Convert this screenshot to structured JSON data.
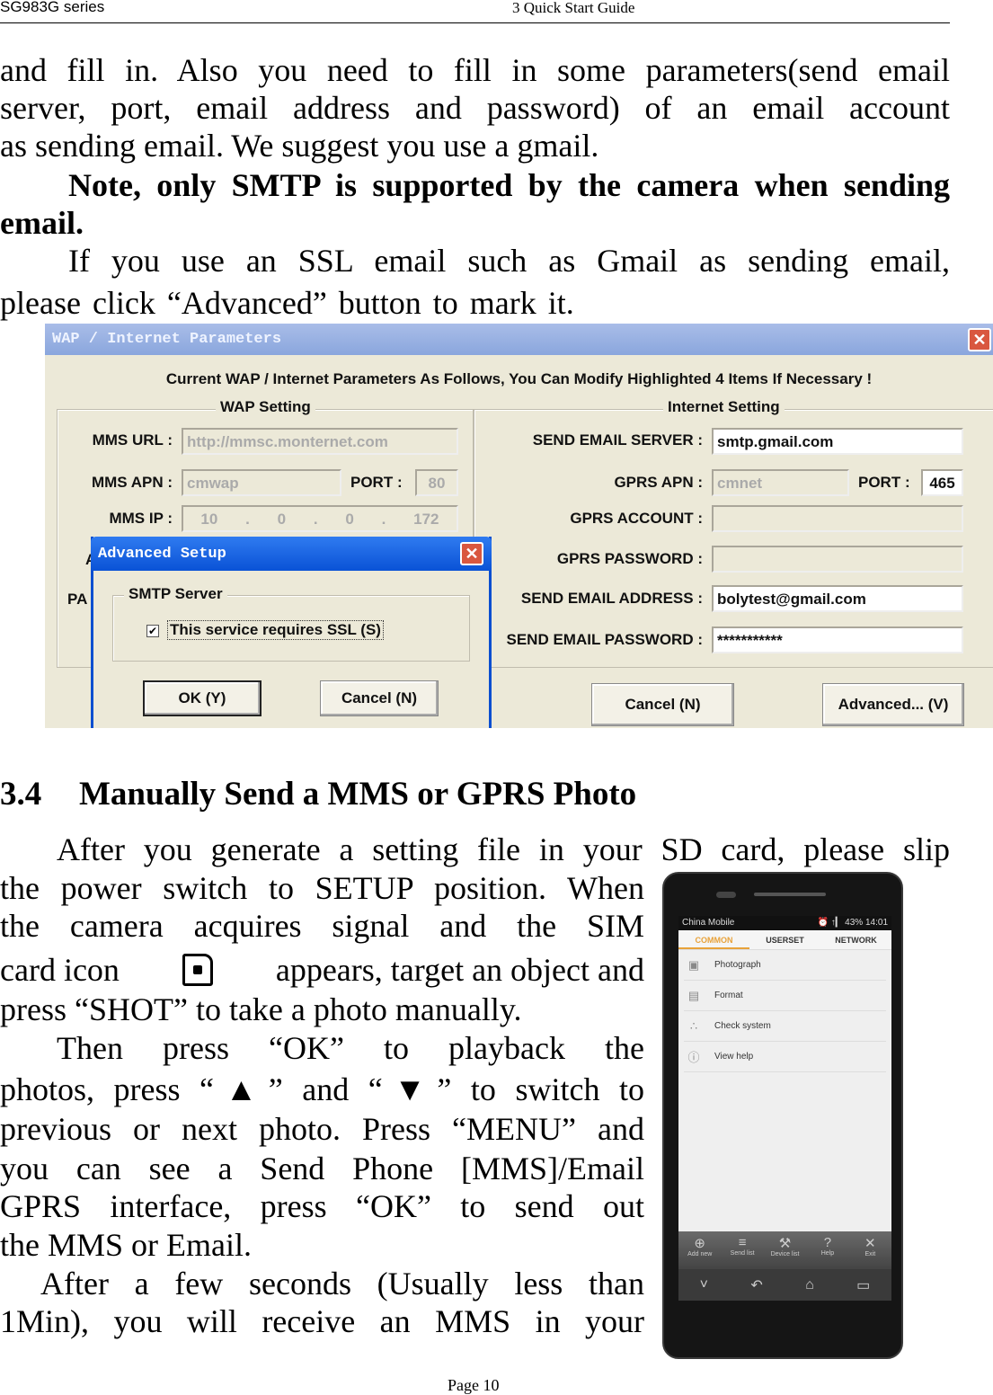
{
  "header": {
    "left": "SG983G series",
    "center": "3 Quick Start Guide"
  },
  "p1": [
    "and fill in. Also you need to fill in some parameters(send email",
    "server, port, email address and password) of an email account",
    "as sending email. We suggest you use a gmail."
  ],
  "note": [
    "Note, only SMTP is supported by the camera when sending",
    "email."
  ],
  "p2": [
    "If you use an SSL email such as Gmail as sending email,",
    "please click “Advanced” button to mark it."
  ],
  "dialog": {
    "title": "WAP / Internet Parameters",
    "close": "✕",
    "caption": "Current WAP / Internet Parameters As Follows, You Can Modify Highlighted 4 Items If Necessary !",
    "wap": {
      "legend": "WAP Setting",
      "mms_url_label": "MMS URL :",
      "mms_url": "http://mmsc.monternet.com",
      "mms_apn_label": "MMS APN :",
      "mms_apn": "cmwap",
      "port_label": "PORT :",
      "port": "80",
      "mms_ip_label": "MMS IP :",
      "mms_ip": [
        "10",
        ".",
        "0",
        ".",
        "0",
        ".",
        "172"
      ],
      "hidden1": "A",
      "hidden2": "PA"
    },
    "internet": {
      "legend": "Internet Setting",
      "server_label": "SEND EMAIL SERVER :",
      "server": "smtp.gmail.com",
      "gprs_apn_label": "GPRS APN :",
      "gprs_apn": "cmnet",
      "port_label": "PORT :",
      "port": "465",
      "account_label": "GPRS ACCOUNT :",
      "account": "",
      "password_label": "GPRS PASSWORD :",
      "password": "",
      "address_label": "SEND EMAIL ADDRESS :",
      "address": "bolytest@gmail.com",
      "email_password_label": "SEND EMAIL PASSWORD :",
      "email_password": "***********"
    },
    "cancel": "Cancel (N)",
    "advanced": "Advanced... (V)",
    "adv": {
      "title": "Advanced Setup",
      "close": "✕",
      "legend": "SMTP Server",
      "ssl_label": "This service requires SSL (S)",
      "ssl_checked": true,
      "ok": "OK (Y)",
      "cancel": "Cancel (N)"
    }
  },
  "section": {
    "number": "3.4",
    "title": "Manually Send a MMS or GPRS Photo"
  },
  "p3": {
    "first": "After you generate a setting file in your SD card, please slip",
    "lines": [
      "the power switch to SETUP position. When",
      "the camera acquires signal and the SIM"
    ],
    "icon_a": "card icon",
    "icon_b": "appears, target an object and",
    "rest": [
      "press “SHOT” to take a photo manually.",
      "Then press “OK” to playback the",
      "photos, press “▲” and “▼” to switch to",
      "previous or next photo. Press “MENU” and",
      "you can see a Send Phone [MMS]/Email",
      "GPRS interface, press “OK” to send out",
      "the MMS or Email.",
      "After a few seconds (Usually less than",
      "1Min), you will receive an MMS in your"
    ]
  },
  "phone": {
    "carrier": "China Mobile",
    "status": "⏰ ↑▎ 43% 14:01",
    "tabs": [
      "COMMON",
      "USERSET",
      "NETWORK"
    ],
    "items": [
      {
        "icon": "camera-icon",
        "glyph": "▣",
        "label": "Photograph"
      },
      {
        "icon": "floppy-icon",
        "glyph": "▤",
        "label": "Format"
      },
      {
        "icon": "share-icon",
        "glyph": "∴",
        "label": "Check system"
      },
      {
        "icon": "alert-icon",
        "glyph": "ⓘ",
        "label": "View help"
      }
    ],
    "toolbar": [
      {
        "glyph": "⊕",
        "label": "Add new"
      },
      {
        "glyph": "≡",
        "label": "Send list"
      },
      {
        "glyph": "⚒",
        "label": "Device list"
      },
      {
        "glyph": "?",
        "label": "Help"
      },
      {
        "glyph": "✕",
        "label": "Exit"
      }
    ],
    "nav": [
      "˅",
      "↶",
      "⌂",
      "▭"
    ]
  },
  "footer": "Page 10"
}
